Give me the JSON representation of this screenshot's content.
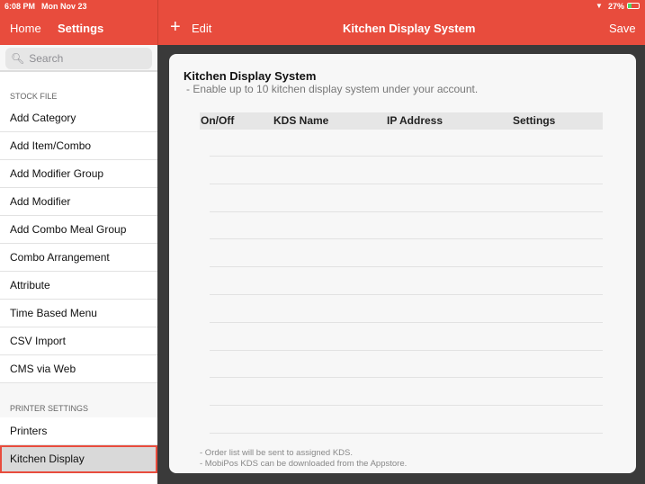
{
  "status_bar": {
    "time": "6:08 PM",
    "date": "Mon Nov 23",
    "battery": "27%"
  },
  "nav": {
    "home": "Home",
    "settings": "Settings",
    "edit": "Edit",
    "title": "Kitchen Display System",
    "save": "Save"
  },
  "sidebar": {
    "search_placeholder": "Search",
    "stock_section": "STOCK FILE",
    "stock_items": [
      "Add Category",
      "Add Item/Combo",
      "Add Modifier Group",
      "Add Modifier",
      "Add Combo Meal Group",
      "Combo Arrangement",
      "Attribute",
      "Time Based Menu",
      "CSV Import",
      "CMS via Web"
    ],
    "printer_section": "PRINTER SETTINGS",
    "printer_items": [
      "Printers",
      "Kitchen Display"
    ],
    "selected": "Kitchen Display"
  },
  "content": {
    "title": "Kitchen Display System",
    "subtitle": "- Enable up to 10 kitchen display system under your account.",
    "columns": [
      "On/Off",
      "KDS Name",
      "IP Address",
      "Settings"
    ],
    "notes": [
      "- Order list will be sent to assigned KDS.",
      "- MobiPos KDS can be downloaded from the Appstore."
    ]
  },
  "colors": {
    "accent": "#e84c3d"
  }
}
